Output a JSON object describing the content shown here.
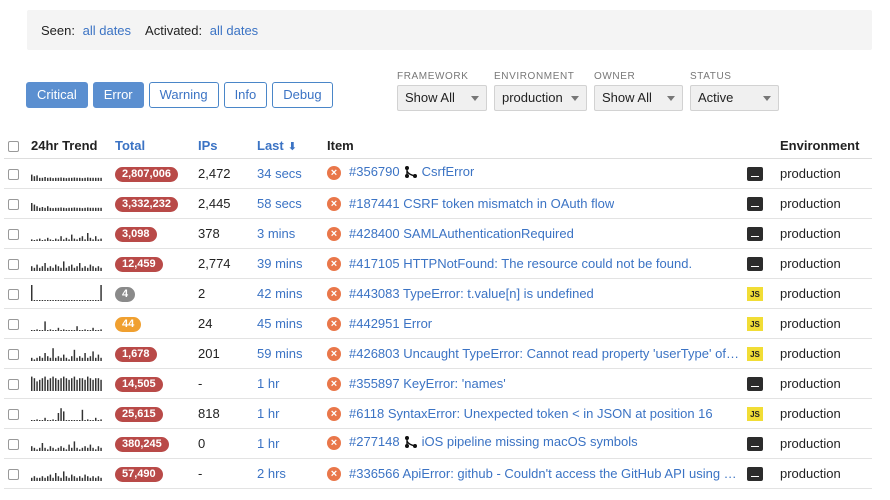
{
  "filters": {
    "seen_label": "Seen:",
    "seen_value": "all dates",
    "activated_label": "Activated:",
    "activated_value": "all dates"
  },
  "levels": [
    {
      "label": "Critical",
      "active": true
    },
    {
      "label": "Error",
      "active": true
    },
    {
      "label": "Warning",
      "active": false
    },
    {
      "label": "Info",
      "active": false
    },
    {
      "label": "Debug",
      "active": false
    }
  ],
  "selects": [
    {
      "label": "FRAMEWORK",
      "value": "Show All",
      "width": 90
    },
    {
      "label": "ENVIRONMENT",
      "value": "production",
      "width": 93
    },
    {
      "label": "OWNER",
      "value": "Show All",
      "width": 89
    },
    {
      "label": "STATUS",
      "value": "Active",
      "width": 89
    }
  ],
  "columns": {
    "trend": "24hr Trend",
    "total": "Total",
    "ips": "IPs",
    "last": "Last",
    "item": "Item",
    "environment": "Environment"
  },
  "colors": {
    "badge_red": "#b94a48",
    "badge_gray": "#8a8a8a",
    "badge_orange": "#f0a030",
    "link": "#3b73c4",
    "active_button": "#5b8fd0"
  },
  "rows": [
    {
      "total": "2,807,006",
      "badge": "red",
      "ips": "2,472",
      "last": "34 secs",
      "item": "#356790",
      "title": "CsrfError",
      "merge": true,
      "platform": "terminal",
      "env": "production",
      "trend": [
        0.4,
        0.3,
        0.35,
        0.2,
        0.2,
        0.25,
        0.2,
        0.22,
        0.18,
        0.2,
        0.2,
        0.22,
        0.2,
        0.18,
        0.2,
        0.2,
        0.22,
        0.2,
        0.2,
        0.18,
        0.2,
        0.22,
        0.2,
        0.2,
        0.2,
        0.2,
        0.2
      ]
    },
    {
      "total": "3,332,232",
      "badge": "red",
      "ips": "2,445",
      "last": "58 secs",
      "item": "#187441",
      "title": "CSRF token mismatch in OAuth flow",
      "merge": false,
      "platform": "terminal",
      "env": "production",
      "trend": [
        0.5,
        0.4,
        0.3,
        0.2,
        0.25,
        0.2,
        0.3,
        0.2,
        0.18,
        0.2,
        0.2,
        0.22,
        0.2,
        0.18,
        0.2,
        0.2,
        0.22,
        0.2,
        0.2,
        0.18,
        0.2,
        0.22,
        0.2,
        0.2,
        0.2,
        0.2,
        0.2
      ]
    },
    {
      "total": "3,098",
      "badge": "red",
      "ips": "378",
      "last": "3 mins",
      "item": "#428400",
      "title": "SAMLAuthenticationRequired",
      "merge": false,
      "platform": "terminal",
      "env": "production",
      "trend": [
        0.1,
        0.05,
        0.1,
        0.15,
        0.05,
        0.1,
        0.2,
        0.1,
        0.05,
        0.15,
        0.1,
        0.3,
        0.1,
        0.2,
        0.1,
        0.4,
        0.15,
        0.1,
        0.2,
        0.3,
        0.1,
        0.5,
        0.2,
        0.1,
        0.3,
        0.1,
        0.15
      ]
    },
    {
      "total": "12,459",
      "badge": "red",
      "ips": "2,774",
      "last": "39 mins",
      "item": "#417105",
      "title": "HTTPNotFound: The resource could not be found.",
      "merge": false,
      "platform": "terminal",
      "env": "production",
      "trend": [
        0.3,
        0.2,
        0.4,
        0.2,
        0.3,
        0.5,
        0.2,
        0.3,
        0.2,
        0.4,
        0.3,
        0.2,
        0.6,
        0.2,
        0.3,
        0.4,
        0.2,
        0.3,
        0.5,
        0.2,
        0.3,
        0.2,
        0.4,
        0.3,
        0.2,
        0.3,
        0.2
      ]
    },
    {
      "total": "4",
      "badge": "gray",
      "ips": "2",
      "last": "42 mins",
      "item": "#443083",
      "title": "TypeError: t.value[n] is undefined",
      "merge": false,
      "platform": "js",
      "env": "production",
      "trend": [
        1.0,
        0,
        0,
        0,
        0,
        0,
        0,
        0,
        0,
        0,
        0,
        0,
        0,
        0,
        0,
        0,
        0,
        0,
        0,
        0,
        0,
        0,
        0,
        0,
        0,
        0,
        1.0
      ]
    },
    {
      "total": "44",
      "badge": "orange",
      "ips": "24",
      "last": "45 mins",
      "item": "#442951",
      "title": "Error",
      "merge": false,
      "platform": "js",
      "env": "production",
      "trend": [
        0,
        0,
        0.1,
        0,
        0,
        0.6,
        0,
        0.1,
        0,
        0,
        0.2,
        0,
        0.1,
        0,
        0,
        0,
        0,
        0.3,
        0,
        0,
        0.1,
        0,
        0,
        0.2,
        0,
        0,
        0.1
      ]
    },
    {
      "total": "1,678",
      "badge": "red",
      "ips": "201",
      "last": "59 mins",
      "item": "#426803",
      "title": "Uncaught TypeError: Cannot read property 'userType' of undefined",
      "merge": false,
      "platform": "js",
      "env": "production",
      "trend": [
        0.2,
        0.1,
        0.2,
        0.3,
        0.2,
        0.5,
        0.3,
        0.2,
        0.8,
        0.2,
        0.3,
        0.2,
        0.4,
        0.2,
        0.1,
        0.3,
        0.7,
        0.2,
        0.3,
        0.2,
        0.5,
        0.2,
        0.3,
        0.6,
        0.2,
        0.4,
        0.2
      ]
    },
    {
      "total": "14,505",
      "badge": "red",
      "ips": "-",
      "last": "1 hr",
      "item": "#355897",
      "title": "KeyError: 'names'",
      "merge": false,
      "platform": "terminal",
      "env": "production",
      "trend": [
        0.9,
        0.8,
        0.6,
        0.7,
        0.8,
        0.9,
        0.7,
        0.8,
        0.9,
        0.8,
        0.7,
        0.8,
        0.9,
        0.8,
        0.7,
        0.8,
        0.9,
        0.7,
        0.8,
        0.8,
        0.7,
        0.9,
        0.8,
        0.7,
        0.8,
        0.8,
        0.7
      ]
    },
    {
      "total": "25,615",
      "badge": "red",
      "ips": "818",
      "last": "1 hr",
      "item": "#6118",
      "title": "SyntaxError: Unexpected token < in JSON at position 16",
      "merge": false,
      "platform": "js",
      "env": "production",
      "trend": [
        0,
        0,
        0.1,
        0,
        0,
        0.2,
        0,
        0,
        0.1,
        0,
        0.5,
        0.8,
        0.6,
        0,
        0,
        0,
        0,
        0,
        0,
        0.7,
        0,
        0.1,
        0,
        0,
        0.2,
        0,
        0.1
      ]
    },
    {
      "total": "380,245",
      "badge": "red",
      "ips": "0",
      "last": "1 hr",
      "item": "#277148",
      "title": "iOS pipeline missing macOS symbols",
      "merge": true,
      "platform": "terminal",
      "env": "production",
      "trend": [
        0.3,
        0.2,
        0.1,
        0.2,
        0.5,
        0.2,
        0.1,
        0.3,
        0.2,
        0.1,
        0.2,
        0.3,
        0.2,
        0.1,
        0.4,
        0.2,
        0.6,
        0.2,
        0.1,
        0.2,
        0.3,
        0.2,
        0.4,
        0.2,
        0.1,
        0.3,
        0.2
      ]
    },
    {
      "total": "57,490",
      "badge": "red",
      "ips": "-",
      "last": "2 hrs",
      "item": "#336566",
      "title": "ApiError: github - Couldn't access the GitHub API using your credentials",
      "merge": false,
      "platform": "terminal",
      "env": "production",
      "trend": [
        0.2,
        0.3,
        0.2,
        0.2,
        0.3,
        0.2,
        0.3,
        0.4,
        0.2,
        0.5,
        0.3,
        0.2,
        0.6,
        0.3,
        0.2,
        0.4,
        0.3,
        0.2,
        0.3,
        0.2,
        0.4,
        0.3,
        0.2,
        0.3,
        0.2,
        0.3,
        0.2
      ]
    }
  ]
}
